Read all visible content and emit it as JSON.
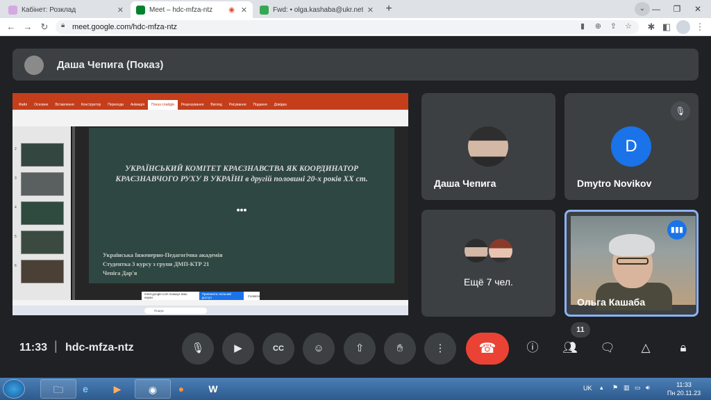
{
  "browser": {
    "tabs": [
      {
        "title": "Кабінет: Розклад",
        "favicon_color": "#d4a8e0",
        "active": false
      },
      {
        "title": "Meet – hdc-mfza-ntz",
        "favicon_color": "#00832d",
        "active": true
      },
      {
        "title": "Fwd: • olga.kashaba@ukr.net",
        "favicon_color": "#34a853",
        "active": false
      }
    ],
    "new_tab": "+",
    "url": "meet.google.com/hdc-mfza-ntz"
  },
  "meet": {
    "header_name": "Даша Чепига (Показ)",
    "presentation": {
      "slide_title": "УКРАЇНСЬКИЙ КОМІТЕТ КРАЄЗНАВСТВА ЯК КООРДИНАТОР КРАЄЗНАВЧОГО РУХУ В УКРАЇНІ в другій половині 20-х років ХХ ст.",
      "slide_dots": "•••",
      "slide_lines": [
        "Українська Інженерно-Педагогічна академія",
        "Студентка 3 курсу з групи ДМП-КТР 21",
        "Чепіга Дар'я"
      ],
      "share_notice": "meet.google.com показує ваш екран",
      "share_stop": "Припинити спільний доступ",
      "share_hide": "Сховати",
      "ribbon_tabs": [
        "Файл",
        "Основне",
        "Вставлення",
        "Конструктор",
        "Переходи",
        "Анімація",
        "Показ слайдів",
        "Рецензування",
        "Вигляд",
        "Рисування",
        "Подання",
        "Довідка"
      ],
      "win_search": "Пошук"
    },
    "tiles": [
      {
        "name": "Даша Чепига"
      },
      {
        "name": "Dmytro Novikov",
        "initial": "D"
      },
      {
        "name": "Ещё 7 чел."
      },
      {
        "name": "Ольга Кашаба"
      }
    ],
    "time": "11:33",
    "separator": "|",
    "meeting_code": "hdc-mfza-ntz",
    "participants_count": "11"
  },
  "taskbar": {
    "lang": "UK",
    "time": "11:33",
    "date": "Пн 20.11.23"
  }
}
